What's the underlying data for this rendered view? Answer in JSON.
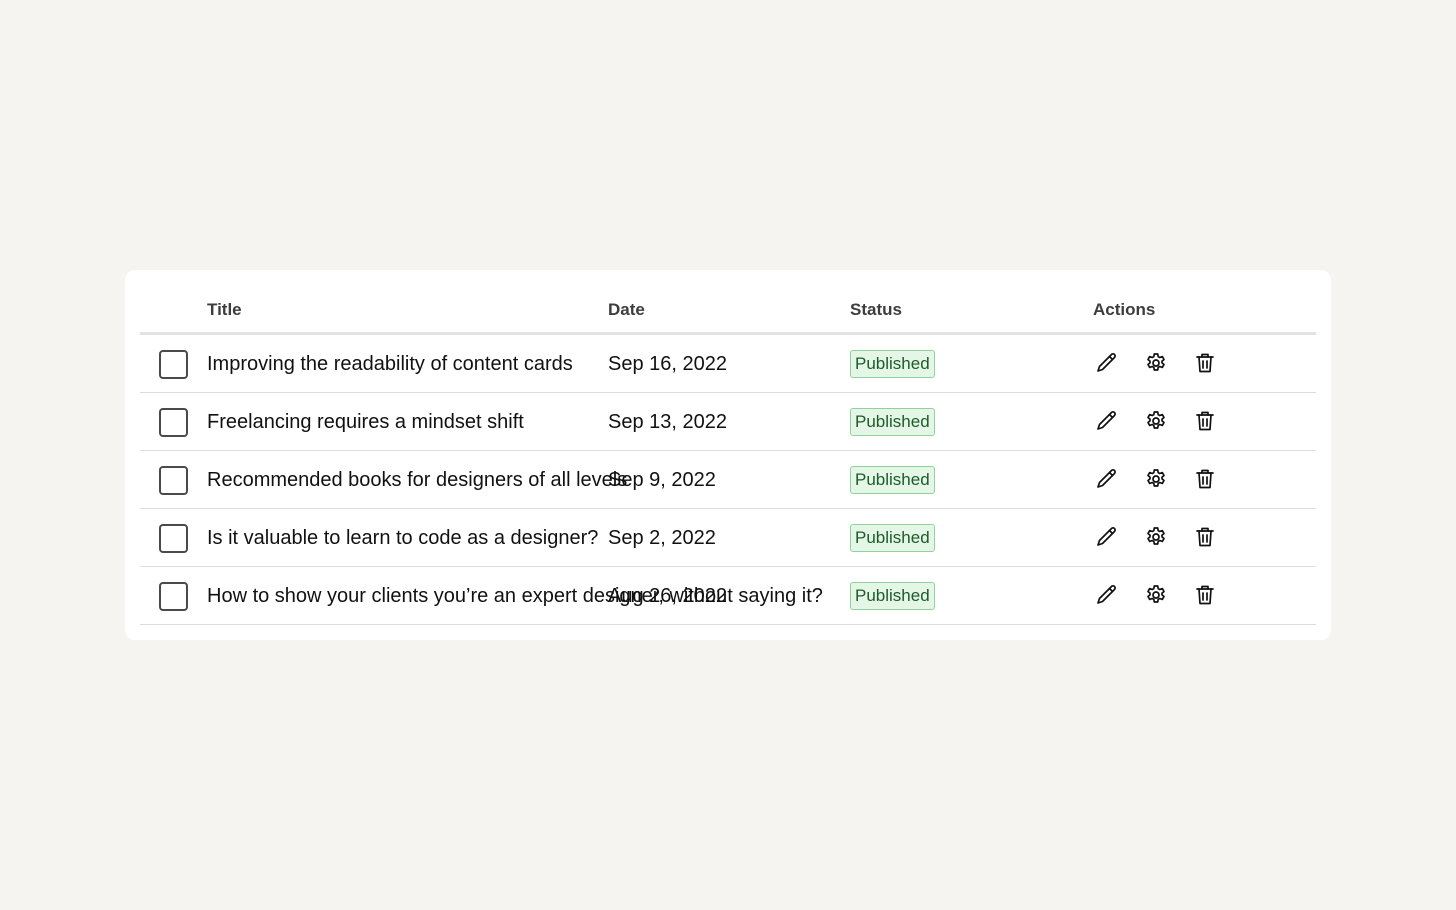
{
  "table": {
    "columns": {
      "title": "Title",
      "date": "Date",
      "status": "Status",
      "actions": "Actions"
    },
    "rows": [
      {
        "title": "Improving the readability of content cards",
        "date": "Sep 16, 2022",
        "status": "Published"
      },
      {
        "title": "Freelancing requires a mindset shift",
        "date": "Sep 13, 2022",
        "status": "Published"
      },
      {
        "title": "Recommended books for designers of all levels",
        "date": "Sep 9, 2022",
        "status": "Published"
      },
      {
        "title": "Is it valuable to learn to code as a designer?",
        "date": "Sep 2, 2022",
        "status": "Published"
      },
      {
        "title": "How to show your clients you’re an expert designer, without saying it?",
        "date": "Aug 26, 2022",
        "status": "Published"
      }
    ],
    "row_icons": [
      "pencil-icon",
      "gear-icon",
      "trash-icon"
    ]
  },
  "colors": {
    "page_background": "#f5f4f0",
    "card_background": "#ffffff",
    "badge_background": "#e4f7e6",
    "badge_border": "#8fd39a",
    "badge_text": "#1f5a2b"
  }
}
